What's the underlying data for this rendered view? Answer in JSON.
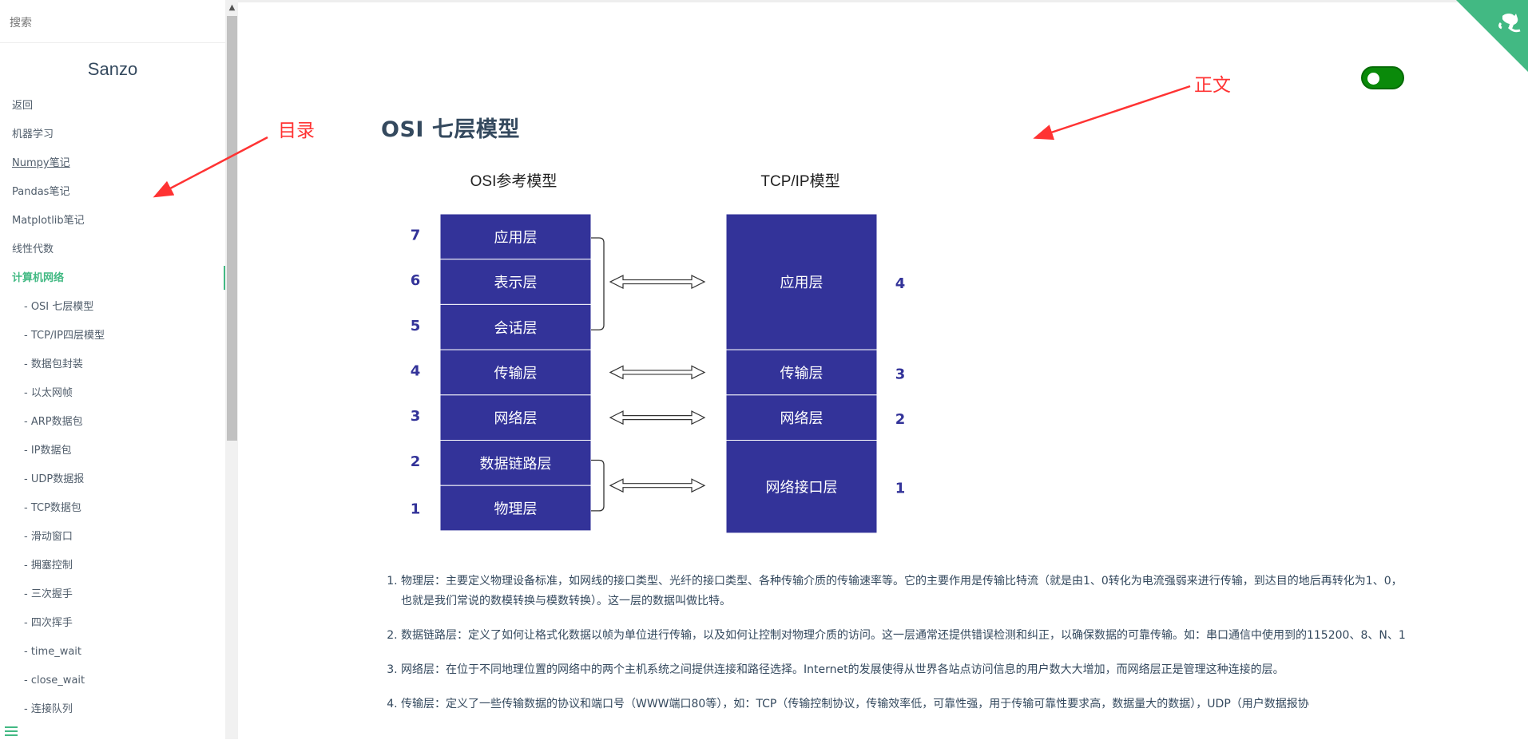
{
  "search": {
    "placeholder": "搜索"
  },
  "sidebar": {
    "app_name": "Sanzo",
    "items": [
      {
        "label": "返回",
        "level": 0
      },
      {
        "label": "机器学习",
        "level": 0
      },
      {
        "label": "Numpy笔记",
        "level": 0,
        "underline": true
      },
      {
        "label": "Pandas笔记",
        "level": 0
      },
      {
        "label": "Matplotlib笔记",
        "level": 0
      },
      {
        "label": "线性代数",
        "level": 0
      },
      {
        "label": "计算机网络",
        "level": 0,
        "active": true
      },
      {
        "label": "- OSI 七层模型",
        "level": 1
      },
      {
        "label": "- TCP/IP四层模型",
        "level": 1
      },
      {
        "label": "- 数据包封装",
        "level": 1
      },
      {
        "label": "- 以太网帧",
        "level": 1
      },
      {
        "label": "- ARP数据包",
        "level": 1
      },
      {
        "label": "- IP数据包",
        "level": 1
      },
      {
        "label": "- UDP数据报",
        "level": 1
      },
      {
        "label": "- TCP数据包",
        "level": 1
      },
      {
        "label": "- 滑动窗口",
        "level": 1
      },
      {
        "label": "- 拥塞控制",
        "level": 1
      },
      {
        "label": "- 三次握手",
        "level": 1
      },
      {
        "label": "- 四次挥手",
        "level": 1
      },
      {
        "label": "- time_wait",
        "level": 1
      },
      {
        "label": "- close_wait",
        "level": 1
      },
      {
        "label": "- 连接队列",
        "level": 1
      }
    ]
  },
  "annotations": {
    "toc": "目录",
    "body": "正文"
  },
  "colors": {
    "accent": "#42b983",
    "annotation": "#ff3333",
    "diagram_block": "#333399",
    "toggle": "#0a8a0a"
  },
  "icons": {
    "menu": "hamburger-menu-icon",
    "corner": "github-octocat-corner-icon",
    "toggle": "theme-toggle-switch"
  },
  "main": {
    "title": "OSI 七层模型",
    "diagram": {
      "osi_title": "OSI参考模型",
      "tcp_title": "TCP/IP模型",
      "osi_layers": [
        {
          "num": "7",
          "label": "应用层"
        },
        {
          "num": "6",
          "label": "表示层"
        },
        {
          "num": "5",
          "label": "会话层"
        },
        {
          "num": "4",
          "label": "传输层"
        },
        {
          "num": "3",
          "label": "网络层"
        },
        {
          "num": "2",
          "label": "数据链路层"
        },
        {
          "num": "1",
          "label": "物理层"
        }
      ],
      "tcp_layers": [
        {
          "num": "4",
          "label": "应用层"
        },
        {
          "num": "3",
          "label": "传输层"
        },
        {
          "num": "2",
          "label": "网络层"
        },
        {
          "num": "1",
          "label": "网络接口层"
        }
      ]
    },
    "list": [
      "物理层：主要定义物理设备标准，如网线的接口类型、光纤的接口类型、各种传输介质的传输速率等。它的主要作用是传输比特流（就是由1、0转化为电流强弱来进行传输，到达目的地后再转化为1、0，也就是我们常说的数模转换与模数转换）。这一层的数据叫做比特。",
      "数据链路层：定义了如何让格式化数据以帧为单位进行传输，以及如何让控制对物理介质的访问。这一层通常还提供错误检测和纠正，以确保数据的可靠传输。如：串口通信中使用到的115200、8、N、1",
      "网络层：在位于不同地理位置的网络中的两个主机系统之间提供连接和路径选择。Internet的发展使得从世界各站点访问信息的用户数大大增加，而网络层正是管理这种连接的层。",
      "传输层：定义了一些传输数据的协议和端口号（WWW端口80等），如：TCP（传输控制协议，传输效率低，可靠性强，用于传输可靠性要求高，数据量大的数据），UDP（用户数据报协"
    ]
  }
}
